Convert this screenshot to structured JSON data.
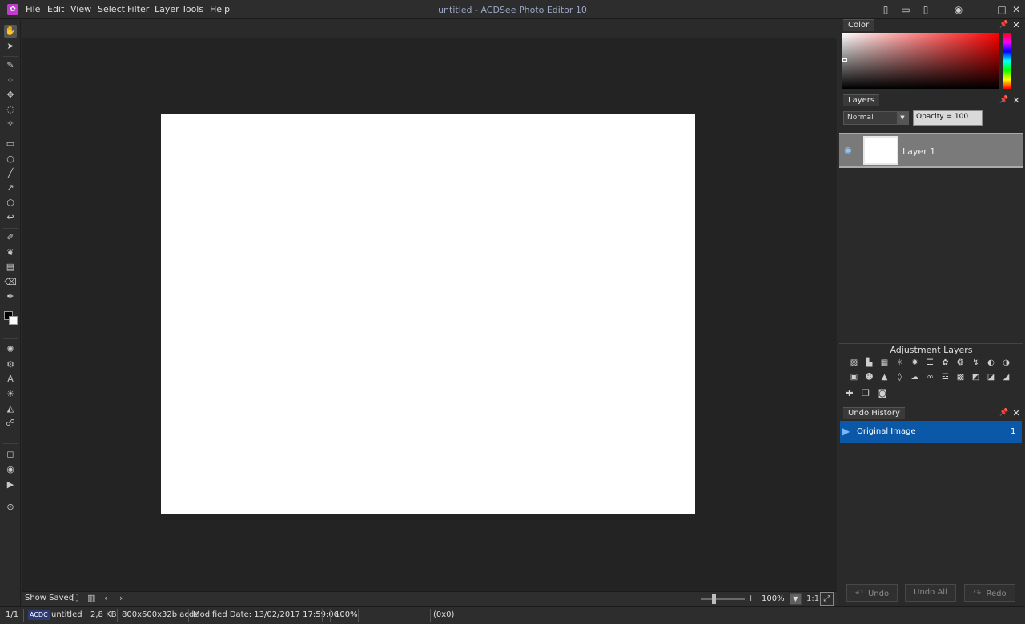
{
  "app": {
    "window_title": "untitled - ACDSee Photo Editor 10",
    "menu": [
      "File",
      "Edit",
      "View",
      "Select",
      "Filter",
      "Layer",
      "Tools",
      "Help"
    ]
  },
  "canvas_status": {
    "show_saved_label": "Show Saved",
    "zoom_value": "100%",
    "ratio_label": "1:1"
  },
  "panels": {
    "color": {
      "title": "Color"
    },
    "layers": {
      "title": "Layers",
      "blend_mode": "Normal",
      "opacity_label": "Opacity = 100",
      "items": [
        {
          "name": "Layer 1"
        }
      ]
    },
    "adjustment_layers": {
      "title": "Adjustment Layers"
    },
    "undo_history": {
      "title": "Undo History",
      "items": [
        {
          "label": "Original Image",
          "count": "1"
        }
      ],
      "buttons": {
        "undo": "Undo",
        "undo_all": "Undo All",
        "redo": "Redo"
      }
    }
  },
  "statusbar": {
    "page": "1/1",
    "format_badge": "ACDC",
    "filename": "untitled",
    "filesize": "2,8 KB",
    "dimensions": "800x600x32b acdc",
    "modified": "Modified Date: 13/02/2017 17:59:06",
    "zoom": "100%",
    "coords": "(0x0)"
  },
  "colors": {
    "accent": "#0c58a8",
    "canvas": "#ffffff",
    "workspace": "#232323"
  }
}
